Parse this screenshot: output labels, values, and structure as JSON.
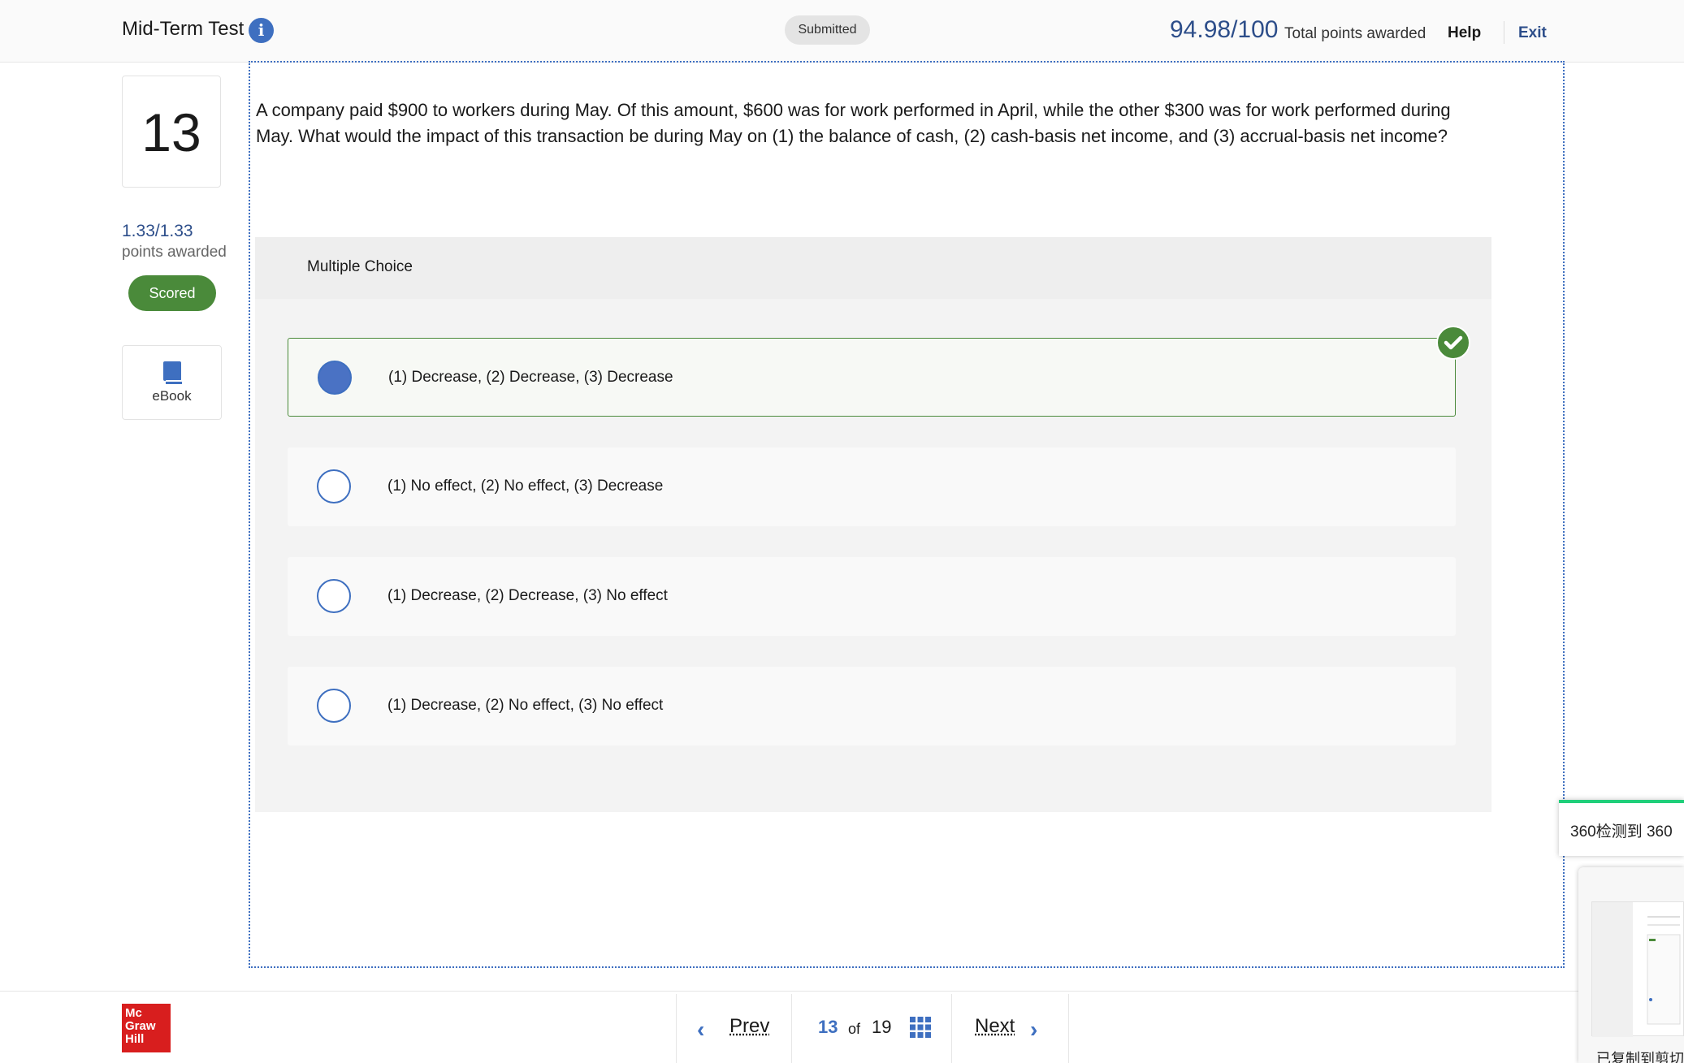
{
  "header": {
    "title": "Mid-Term Test",
    "status": "Submitted",
    "score": "94.98/100",
    "score_label": "Total points awarded",
    "help": "Help",
    "exit": "Exit"
  },
  "sidebar": {
    "question_number": "13",
    "points": "1.33/1.33",
    "points_label": "points awarded",
    "scored_badge": "Scored",
    "ebook_label": "eBook"
  },
  "question": {
    "text": "A company paid $900 to workers during May. Of this amount, $600 was for work performed in April, while the other $300 was for work performed during May. What would the impact of this transaction be during May on (1) the balance of cash, (2) cash-basis net income, and (3) accrual-basis net income?",
    "type_label": "Multiple Choice",
    "options": [
      {
        "label": "(1) Decrease, (2) Decrease, (3) Decrease",
        "selected": true,
        "correct": true
      },
      {
        "label": "(1) No effect, (2) No effect, (3) Decrease",
        "selected": false,
        "correct": false
      },
      {
        "label": "(1) Decrease, (2) Decrease, (3) No effect",
        "selected": false,
        "correct": false
      },
      {
        "label": "(1) Decrease, (2) No effect, (3) No effect",
        "selected": false,
        "correct": false
      }
    ]
  },
  "footer": {
    "logo": "Mc Graw Hill",
    "prev": "Prev",
    "current": "13",
    "of": "of",
    "total": "19",
    "next": "Next"
  },
  "overlay": {
    "toast_text": "360检测到 360",
    "thumb_caption": "已复制到剪切板"
  },
  "colors": {
    "accent": "#3e6fc0",
    "correct": "#4a8a3a",
    "brand": "#d81e1e"
  }
}
